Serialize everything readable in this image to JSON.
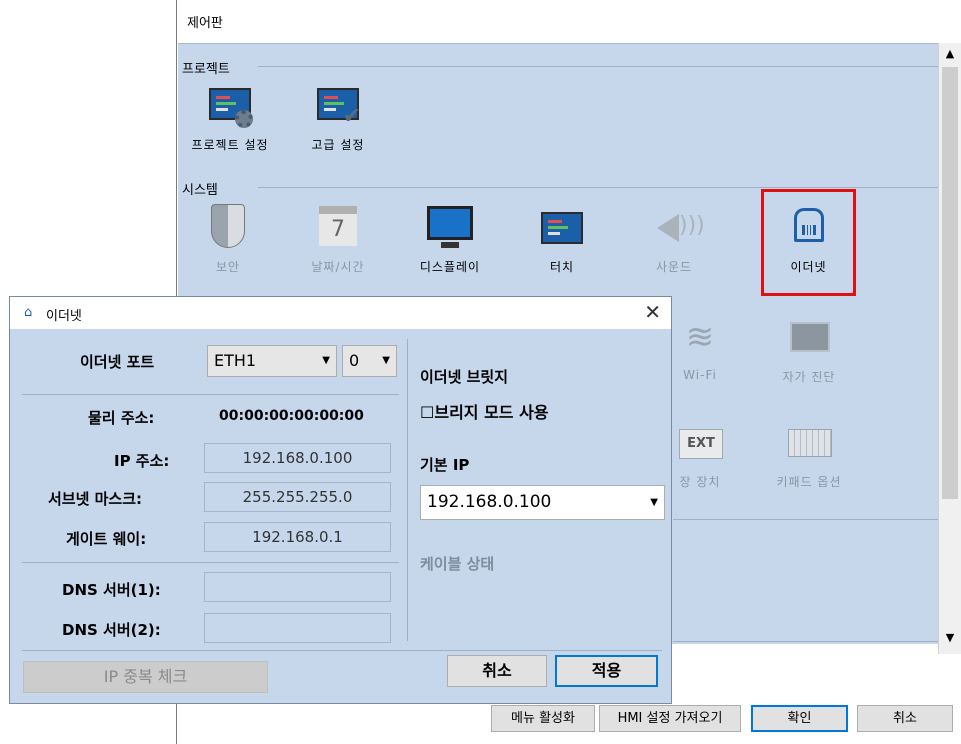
{
  "control_panel": {
    "title": "제어판",
    "groups": {
      "project": {
        "label": "프로젝트",
        "items": [
          {
            "label": "프로젝트 설정"
          },
          {
            "label": "고급 설정"
          }
        ]
      },
      "system": {
        "label": "시스템",
        "items": [
          {
            "label": "보안"
          },
          {
            "label": "날짜/시간"
          },
          {
            "label": "디스플레이"
          },
          {
            "label": "터치"
          },
          {
            "label": "사운드"
          },
          {
            "label": "이더넷"
          },
          {
            "label": "Wi-Fi"
          },
          {
            "label": "자가 진단"
          },
          {
            "label": "장 장치",
            "badge": "EXT"
          },
          {
            "label": "키패드 옵션"
          }
        ]
      }
    },
    "buttons": {
      "menu_activate": "메뉴 활성화",
      "hmi_import": "HMI 설정 가져오기",
      "ok": "확인",
      "cancel": "취소"
    },
    "calendar_day": "7"
  },
  "ethernet_dialog": {
    "title": "이더넷",
    "port_label": "이더넷 포트",
    "port_value": "ETH1",
    "port_index": "0",
    "physical_address_label": "물리 주소:",
    "physical_address": "00:00:00:00:00:00",
    "ip_label": "IP 주소:",
    "ip_value": "192.168.0.100",
    "subnet_label": "서브넷 마스크:",
    "subnet_value": "255.255.255.0",
    "gateway_label": "게이트 웨이:",
    "gateway_value": "192.168.0.1",
    "dns1_label": "DNS 서버(1):",
    "dns1_value": "",
    "dns2_label": "DNS 서버(2):",
    "dns2_value": "",
    "bridge_label": "이더넷 브릿지",
    "bridge_checkbox": "☐브리지 모드 사용",
    "default_ip_label": "기본 IP",
    "default_ip_value": "192.168.0.100",
    "cable_status_label": "케이블 상태",
    "ip_check_button": "IP 중복 체크",
    "cancel_button": "취소",
    "apply_button": "적용"
  },
  "colors": {
    "panel_bg": "#c6d7ec",
    "selection": "#e01010",
    "accent": "#0078d7"
  }
}
